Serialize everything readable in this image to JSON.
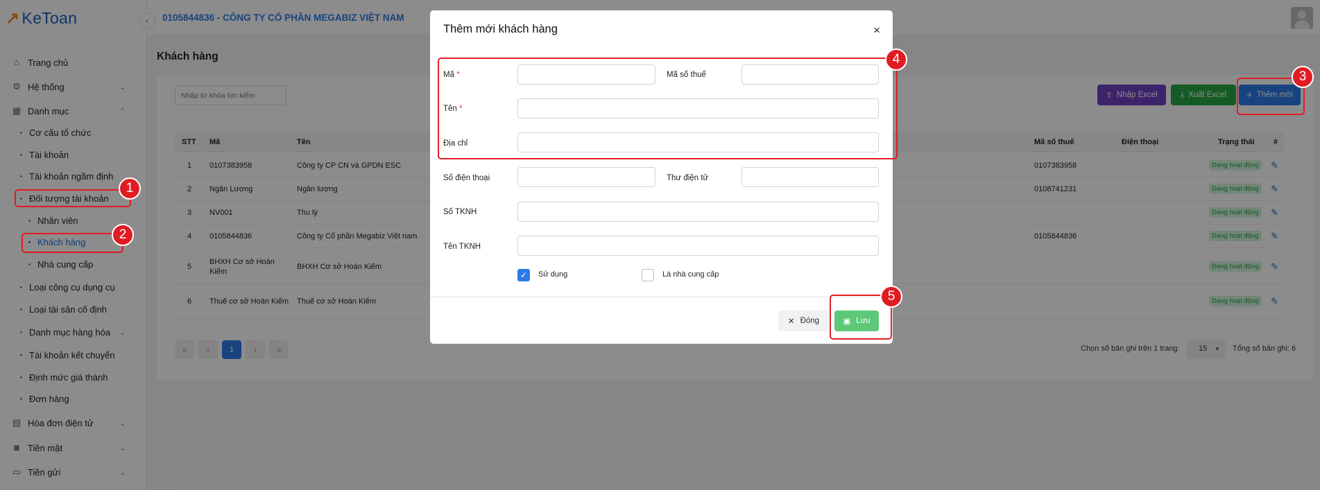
{
  "app": {
    "logo_text": "KeToan",
    "company": "0105844836 - CÔNG TY CỔ PHẦN MEGABIZ VIỆT NAM"
  },
  "sidebar": {
    "items": [
      {
        "label": "Trang chủ",
        "icon": "home-icon"
      },
      {
        "label": "Hệ thống",
        "icon": "gear-icon",
        "chevron": "⌄"
      },
      {
        "label": "Danh mục",
        "icon": "grid-icon",
        "chevron": "⌃"
      },
      {
        "label": "Cơ cấu tổ chức"
      },
      {
        "label": "Tài khoản"
      },
      {
        "label": "Tài khoản ngầm định"
      },
      {
        "label": "Đối tượng tài khoản"
      },
      {
        "label": "Nhân viên"
      },
      {
        "label": "Khách hàng"
      },
      {
        "label": "Nhà cung cấp"
      },
      {
        "label": "Loại công cụ dụng cụ"
      },
      {
        "label": "Loại tài sản cố định"
      },
      {
        "label": "Danh mục hàng hóa",
        "chevron": "⌄"
      },
      {
        "label": "Tài khoản kết chuyển"
      },
      {
        "label": "Định mức giá thành"
      },
      {
        "label": "Đơn hàng"
      },
      {
        "label": "Hóa đơn điện tử",
        "icon": "invoice-icon",
        "chevron": "⌄"
      },
      {
        "label": "Tiền mặt",
        "icon": "cash-icon",
        "chevron": "⌄"
      },
      {
        "label": "Tiền gửi",
        "icon": "bank-icon",
        "chevron": "⌄"
      }
    ]
  },
  "page": {
    "title": "Khách hàng",
    "search_placeholder": "Nhập từ khóa tìm kiếm",
    "buttons": {
      "import": "Nhập Excel",
      "export": "Xuất Excel",
      "add": "Thêm mới"
    }
  },
  "table": {
    "headers": {
      "stt": "STT",
      "ma": "Mã",
      "ten": "Tên",
      "mst": "Mã số thuế",
      "phone": "Điện thoại",
      "status": "Trạng thái",
      "action": "#"
    },
    "rows": [
      {
        "stt": "1",
        "ma": "0107383958",
        "ten": "Công ty CP CN và GPDN ESC",
        "mst": "0107383958",
        "status": "Đang hoạt động"
      },
      {
        "stt": "2",
        "ma": "Ngân Lượng",
        "ten": "Ngân lượng",
        "mst": "0108741231",
        "status": "Đang hoạt động"
      },
      {
        "stt": "3",
        "ma": "NV001",
        "ten": "Thu lý",
        "mst": "",
        "status": "Đang hoạt động"
      },
      {
        "stt": "4",
        "ma": "0105844836",
        "ten": "Công ty Cổ phần Megabiz Việt nam",
        "mst": "0105844836",
        "status": "Đang hoạt động"
      },
      {
        "stt": "5",
        "ma": "BHXH Cơ sở Hoàn Kiếm",
        "ten": "BHXH Cơ sở Hoàn Kiếm",
        "mst": "",
        "status": "Đang hoạt động"
      },
      {
        "stt": "6",
        "ma": "Thuế cơ sở Hoàn Kiếm",
        "ten": "Thuế cơ sở Hoàn Kiếm",
        "mst": "",
        "status": "Đang hoạt động"
      }
    ]
  },
  "pagination": {
    "current": "1",
    "per_page_label": "Chọn số bản ghi trên 1 trang:",
    "per_page": "15",
    "total_label": "Tổng số bản ghi: 6"
  },
  "modal": {
    "title": "Thêm mới khách hàng",
    "fields": {
      "ma": "Mã",
      "mst": "Mã số thuế",
      "ten": "Tên",
      "dia_chi": "Địa chỉ",
      "sdt": "Số điện thoại",
      "email": "Thư điện tử",
      "so_tknh": "Số TKNH",
      "ten_tknh": "Tên TKNH"
    },
    "required_mark": "*",
    "checkboxes": {
      "su_dung": "Sử dụng",
      "su_dung_checked": true,
      "ncc": "Là nhà cung cấp",
      "ncc_checked": false
    },
    "buttons": {
      "close": "Đóng",
      "save": "Lưu"
    }
  },
  "annotations": [
    "1",
    "2",
    "3",
    "4",
    "5"
  ],
  "colors": {
    "primary": "#2c7be5",
    "import": "#6f42c1",
    "export": "#28a745",
    "annotation": "#e01c23",
    "badge_bg": "#d4f2dc",
    "badge_fg": "#27a348"
  }
}
